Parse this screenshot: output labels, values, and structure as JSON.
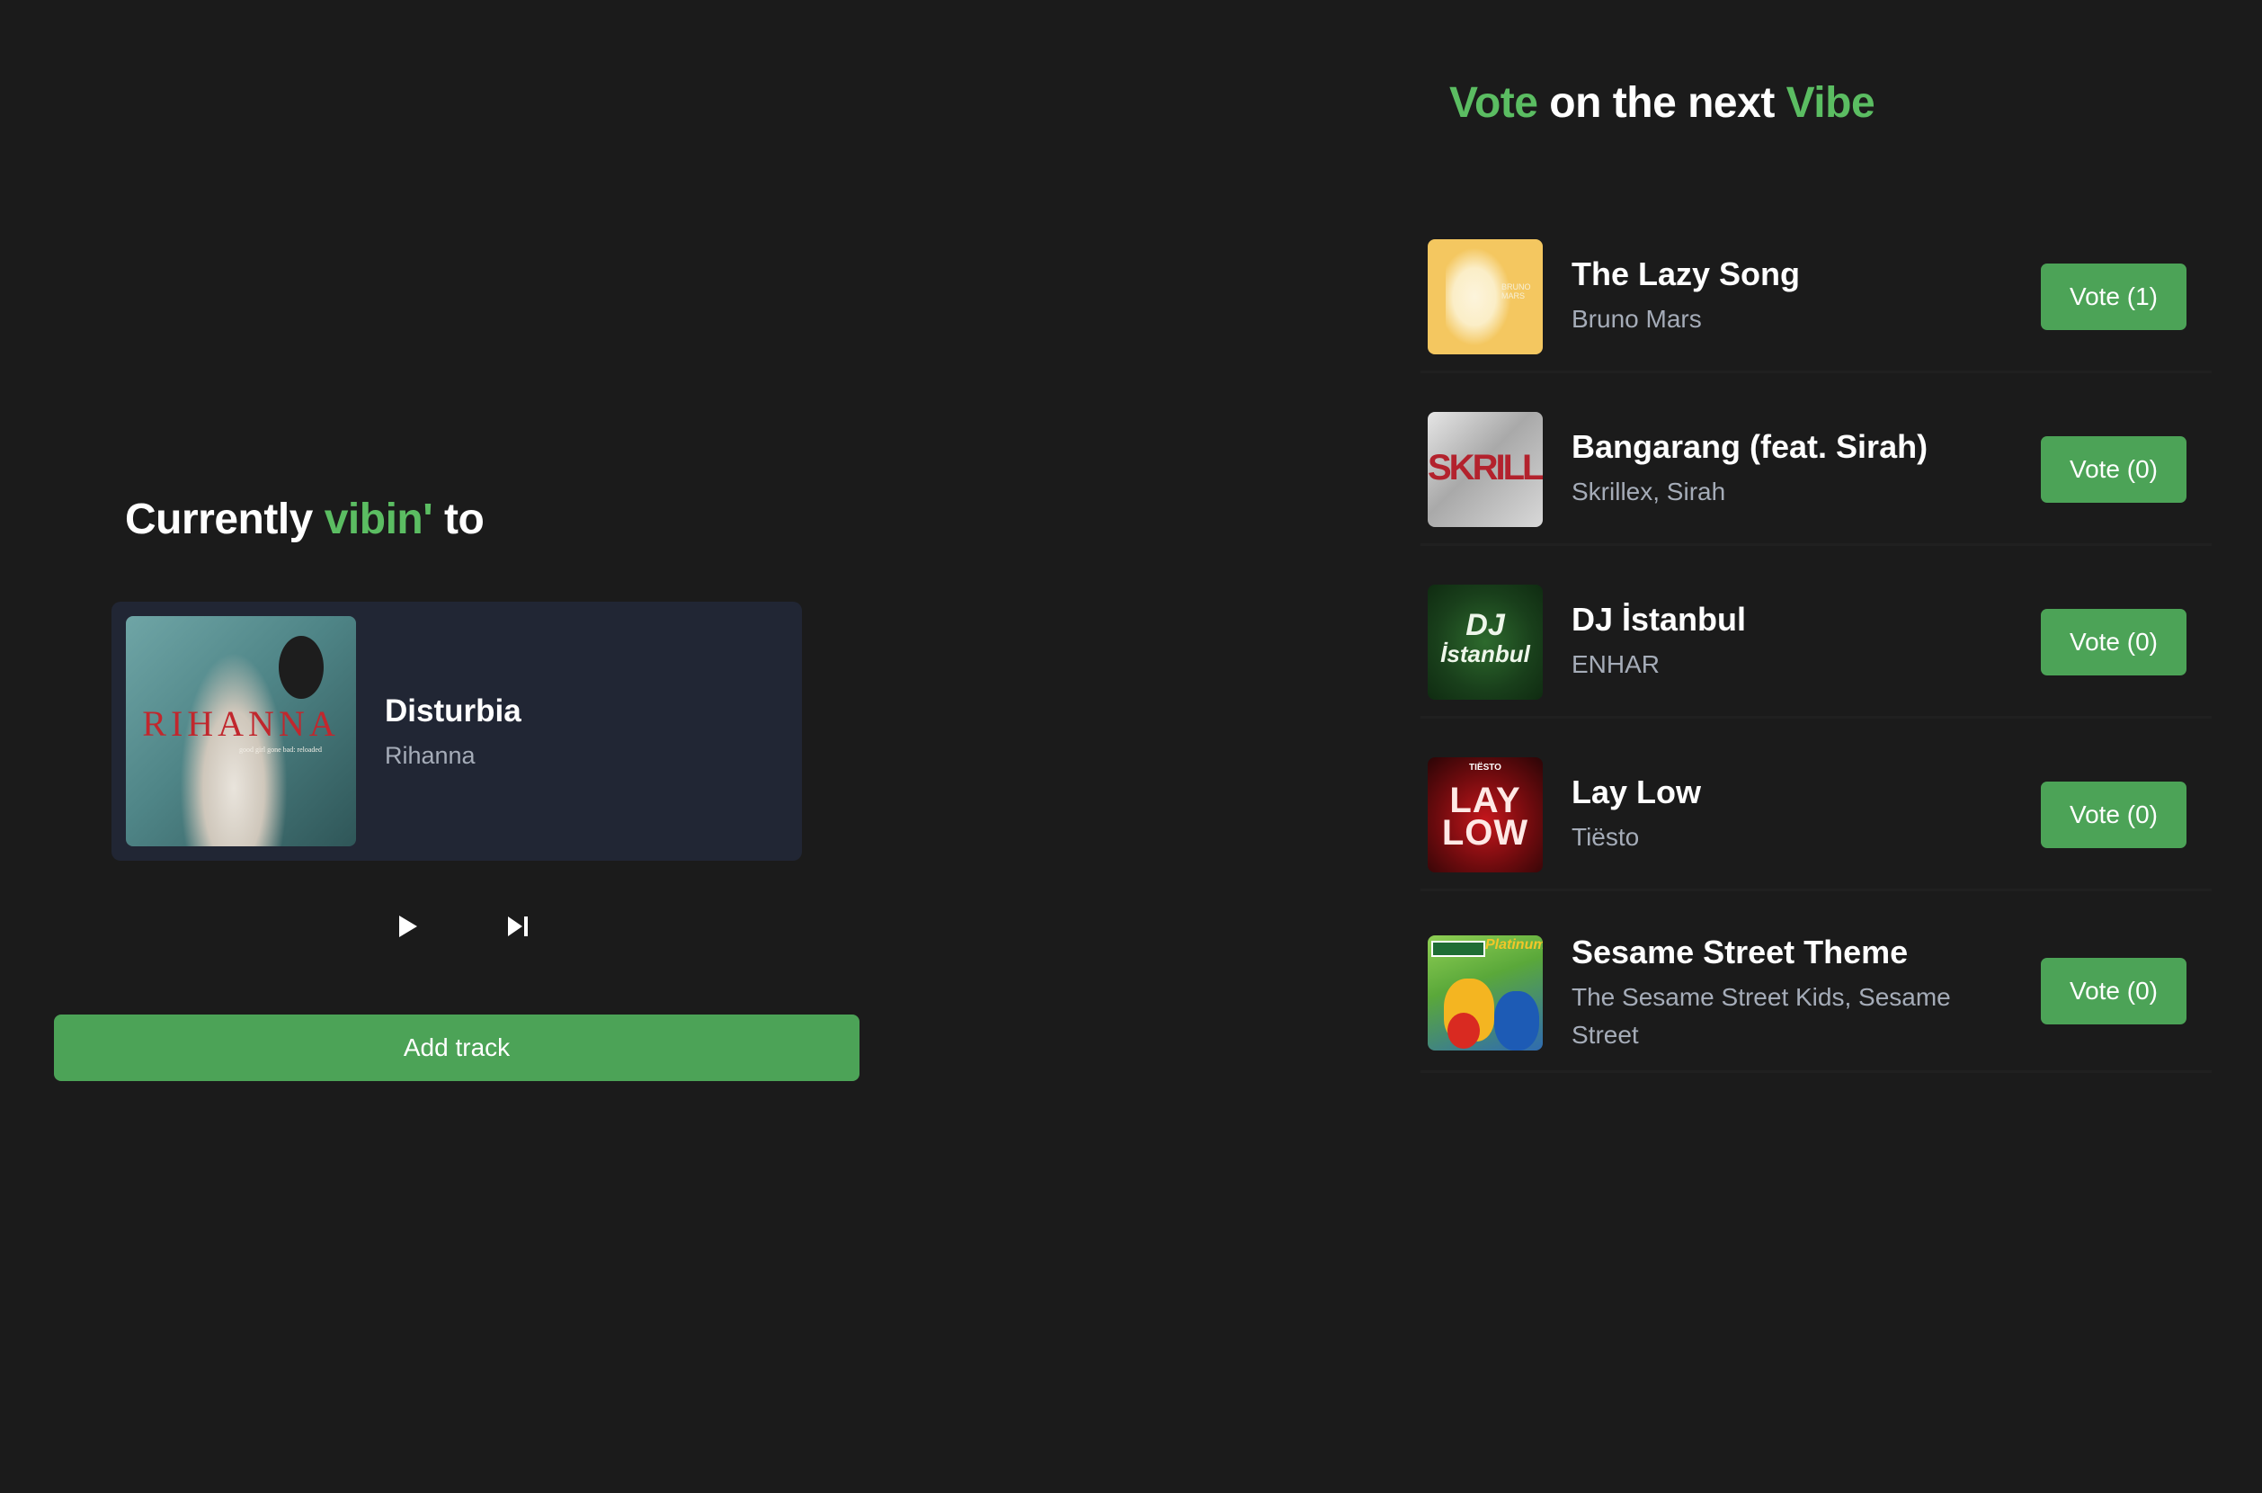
{
  "now_playing": {
    "heading": {
      "part1": "Currently ",
      "accent": "vibin'",
      "part2": " to"
    },
    "track": {
      "title": "Disturbia",
      "artist": "Rihanna",
      "cover_text": "RIHANNA",
      "cover_subtext": "good girl gone bad: reloaded"
    },
    "controls": {
      "play_icon": "play-icon",
      "next_icon": "skip-next-icon"
    },
    "add_track_label": "Add track"
  },
  "vote_panel": {
    "heading": {
      "accent1": "Vote",
      "middle": " on the next ",
      "accent2": "Vibe"
    },
    "tracks": [
      {
        "title": "The Lazy Song",
        "artist": "Bruno Mars",
        "vote_label": "Vote (1)",
        "votes": 1
      },
      {
        "title": "Bangarang (feat. Sirah)",
        "artist": "Skrillex, Sirah",
        "vote_label": "Vote (0)",
        "votes": 0
      },
      {
        "title": "DJ İstanbul",
        "artist": "ENHAR",
        "vote_label": "Vote (0)",
        "votes": 0
      },
      {
        "title": "Lay Low",
        "artist": "Tiësto",
        "vote_label": "Vote (0)",
        "votes": 0
      },
      {
        "title": "Sesame Street Theme",
        "artist": "The Sesame Street Kids, Sesame Street",
        "vote_label": "Vote (0)",
        "votes": 0
      }
    ],
    "cover_texts": {
      "lazy": "BRUNO MARS",
      "skrillex": "SKRILLEX",
      "dj_line1": "DJ",
      "dj_line2": "İstanbul",
      "laylow_top": "TIËSTO",
      "laylow_main": "LAY LOW",
      "sesame_sign": "SESAME STREET",
      "sesame_plat": "Platinum"
    }
  },
  "colors": {
    "background": "#1b1b1b",
    "accent": "#5bbd62",
    "button": "#4ca357",
    "card": "#212634",
    "muted_text": "#a5acb8"
  }
}
